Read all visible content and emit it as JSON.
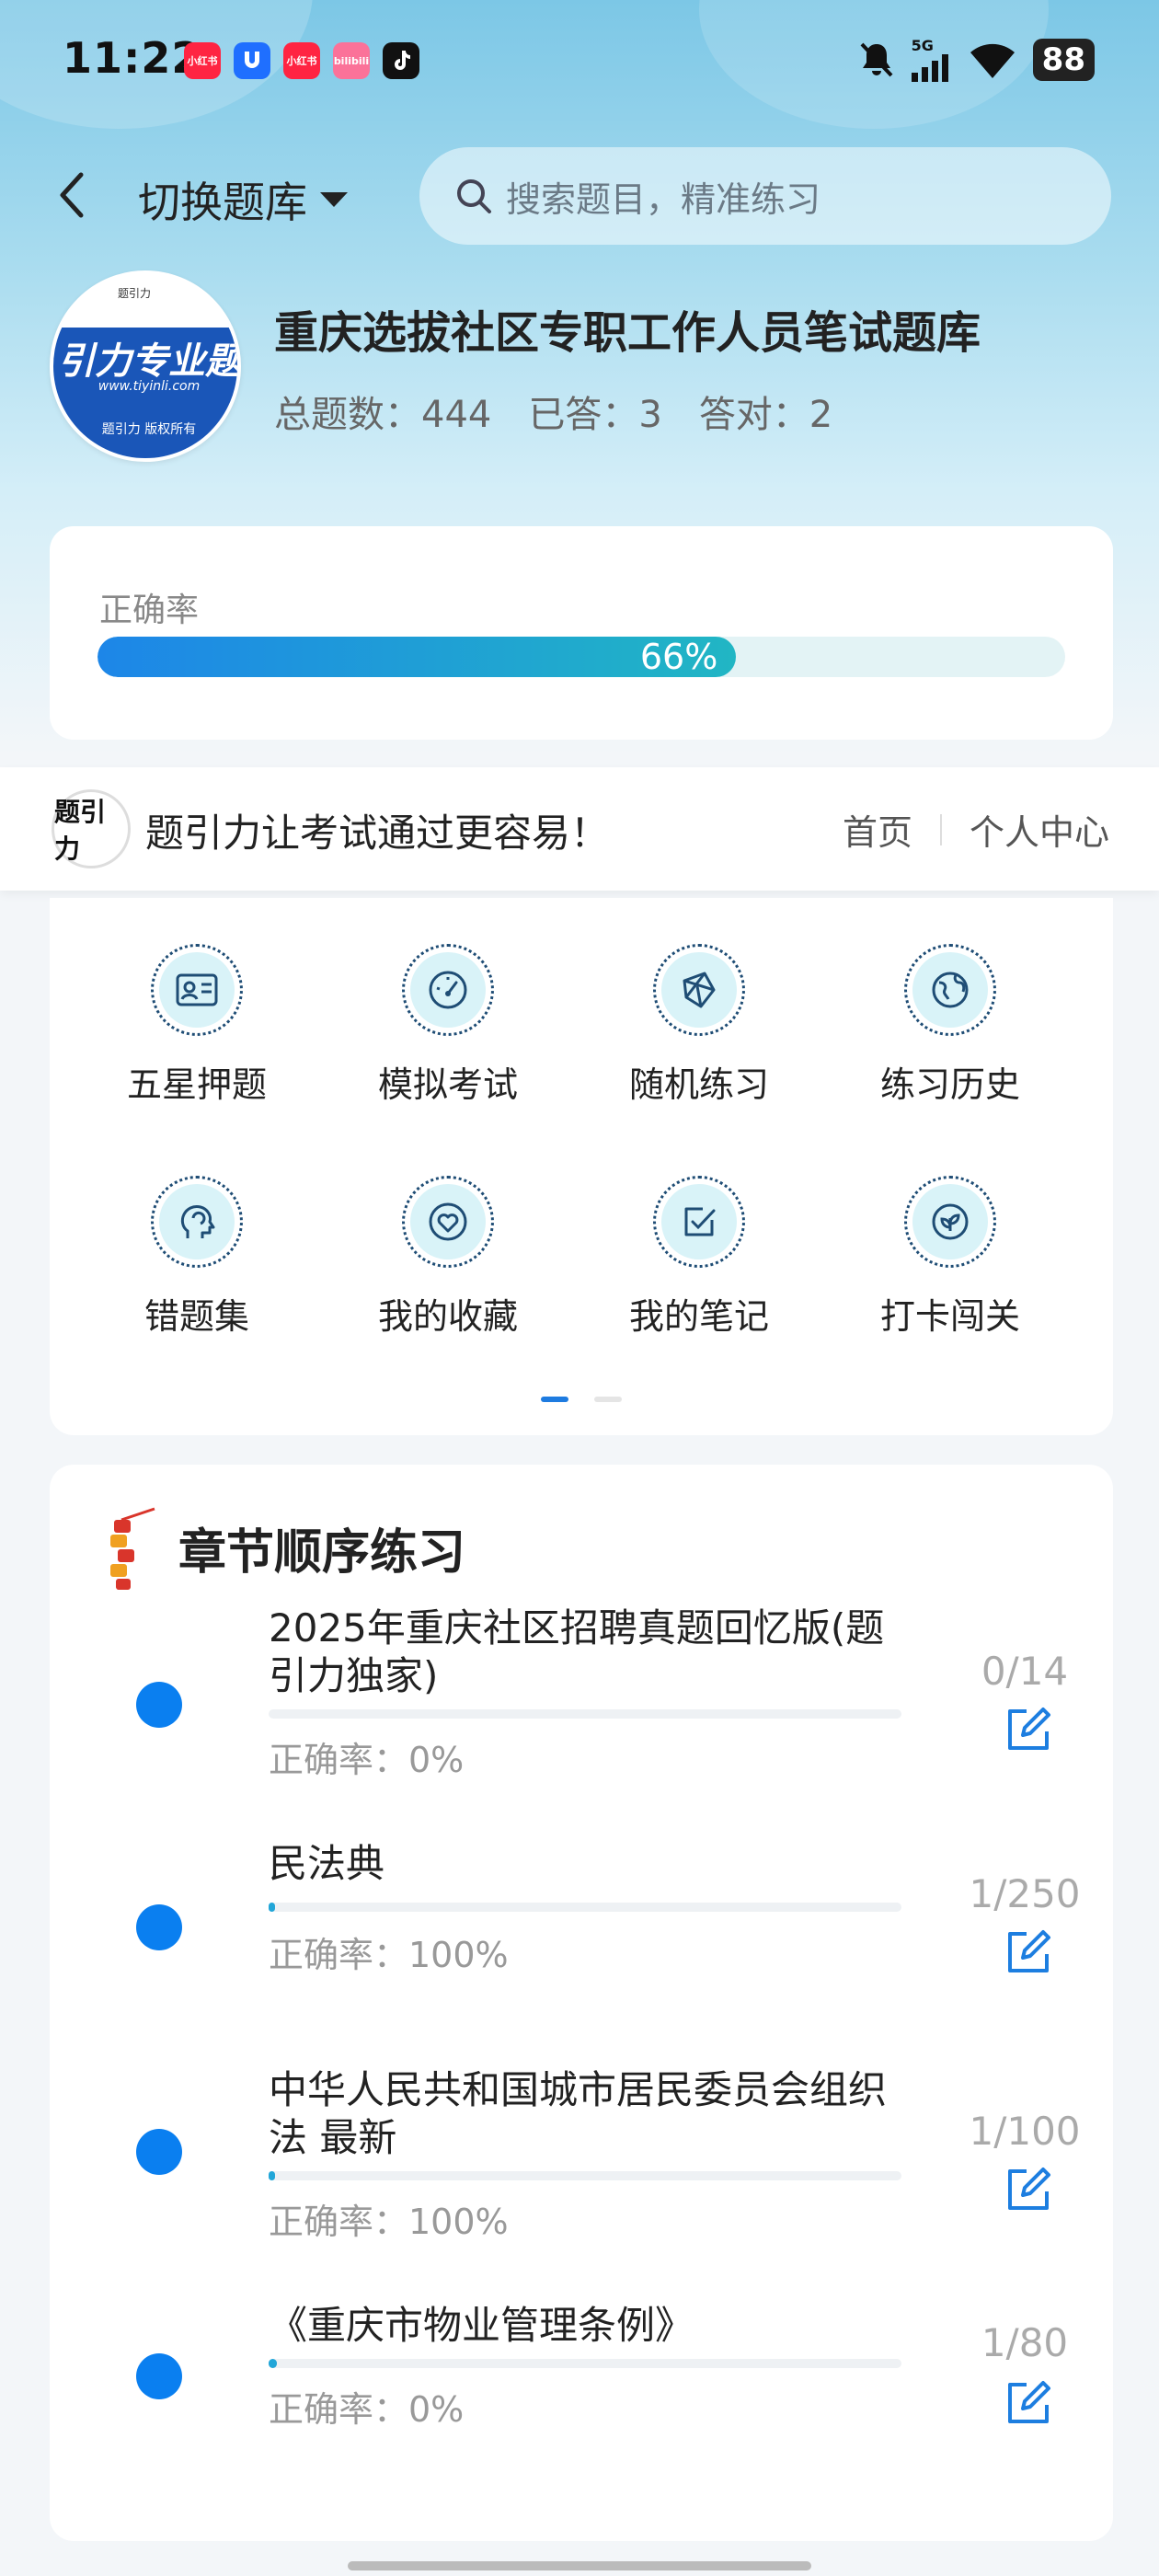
{
  "status_bar": {
    "time": "11:22",
    "battery": "88",
    "network": "5G",
    "app_icons": [
      {
        "label": "小红书",
        "color": "#ff2442"
      },
      {
        "label": "万能连接",
        "color": "#1f6fff"
      },
      {
        "label": "小红书",
        "color": "#ff2442"
      },
      {
        "label": "bilibili",
        "color": "#fb7299"
      },
      {
        "label": "抖音",
        "color": "#111111"
      }
    ]
  },
  "header": {
    "switch_label": "切换题库",
    "search_placeholder": "搜索题目，精准练习"
  },
  "bank": {
    "logo_big_text": "引力专业题",
    "logo_url": "www.tiyinli.com",
    "logo_copyright": "题引力 版权所有",
    "logo_mini": "题引力",
    "title": "重庆选拔社区专职工作人员笔试题库",
    "total": "总题数：444",
    "answered": "已答：3",
    "correct": "答对：2"
  },
  "accuracy": {
    "label": "正确率",
    "percent_text": "66%",
    "value": 0.66
  },
  "banner": {
    "logo_text": "题引力",
    "slogan": "题引力让考试通过更容易！",
    "home": "首页",
    "profile": "个人中心"
  },
  "grid": [
    {
      "label": "五星押题",
      "icon": "id-card-icon"
    },
    {
      "label": "模拟考试",
      "icon": "gauge-icon"
    },
    {
      "label": "随机练习",
      "icon": "network-icon"
    },
    {
      "label": "练习历史",
      "icon": "globe-icon"
    },
    {
      "label": "错题集",
      "icon": "head-icon"
    },
    {
      "label": "我的收藏",
      "icon": "heart-icon"
    },
    {
      "label": "我的笔记",
      "icon": "checkbox-icon"
    },
    {
      "label": "打卡闯关",
      "icon": "leaf-icon"
    }
  ],
  "chapters": {
    "title": "章节顺序练习",
    "items": [
      {
        "name": "2025年重庆社区招聘真题回忆版(题引力独家)",
        "accuracy": "正确率：0%",
        "count": "0/14",
        "progress": 0
      },
      {
        "name": "民法典",
        "accuracy": "正确率：100%",
        "count": "1/250",
        "progress": 0.004
      },
      {
        "name": "中华人民共和国城市居民委员会组织法 最新",
        "accuracy": "正确率：100%",
        "count": "1/100",
        "progress": 0.01
      },
      {
        "name": "《重庆市物业管理条例》",
        "accuracy": "正确率：0%",
        "count": "1/80",
        "progress": 0.0125
      }
    ]
  }
}
